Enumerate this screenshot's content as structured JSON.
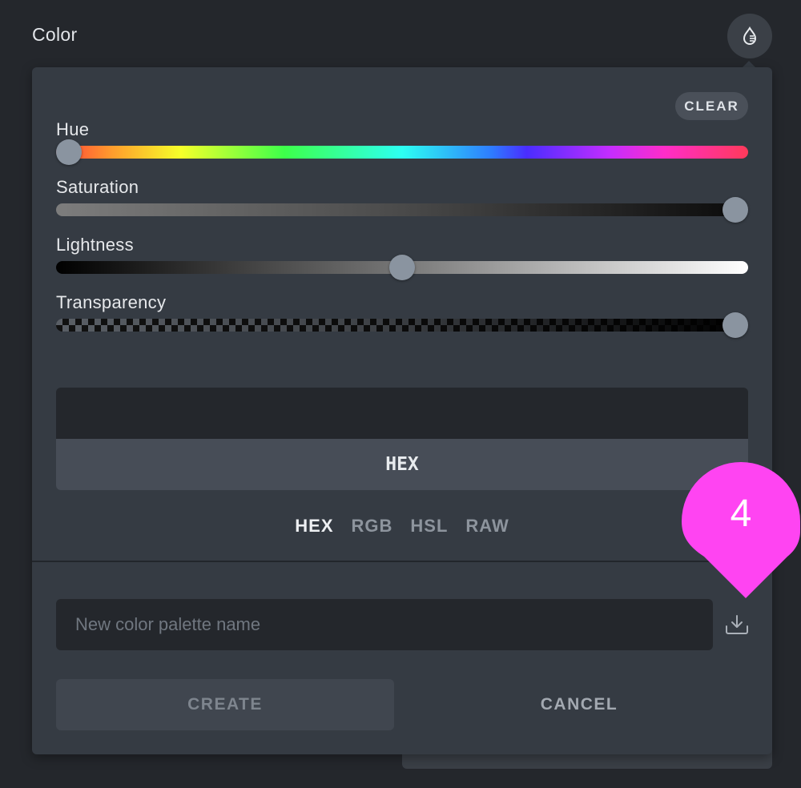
{
  "header": {
    "title": "Color"
  },
  "icons": {
    "header_button": "water-drop-icon",
    "save": "download-icon"
  },
  "picker": {
    "clear_label": "CLEAR",
    "sliders": [
      {
        "label": "Hue",
        "value_percent": 0
      },
      {
        "label": "Saturation",
        "value_percent": 100
      },
      {
        "label": "Lightness",
        "value_percent": 50
      },
      {
        "label": "Transparency",
        "value_percent": 100
      }
    ],
    "preview_color": "#24272c",
    "hex_label": "HEX",
    "formats": [
      "HEX",
      "RGB",
      "HSL",
      "RAW"
    ],
    "active_format": "HEX"
  },
  "palette": {
    "placeholder": "New color palette name",
    "create_label": "CREATE",
    "cancel_label": "CANCEL"
  },
  "annotation": {
    "step": "4",
    "color": "#ff44f2"
  }
}
